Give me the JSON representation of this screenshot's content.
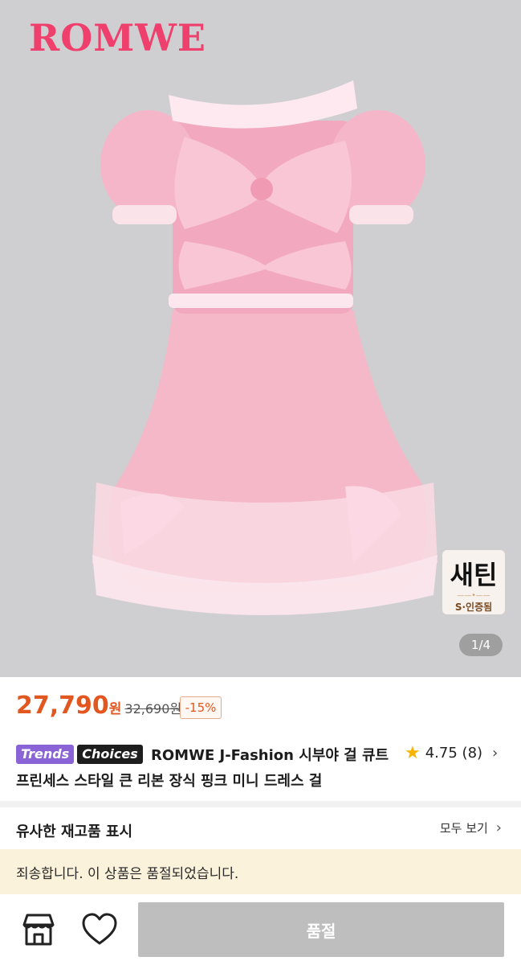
{
  "hero": {
    "brand_logo": "ROMWE",
    "badge_main": "새틴",
    "badge_sub": "S·인증됨",
    "page_indicator": "1/4"
  },
  "price": {
    "sale": "27,790",
    "unit": "원",
    "original": "32,690원",
    "discount": "-15%"
  },
  "product": {
    "tags": [
      "Trends",
      "Choices"
    ],
    "title": "ROMWE J-Fashion 시부야 걸 큐트 프린세스 스타일 큰 리본 장식 핑크 미니 드레스 걸",
    "rating": "4.75",
    "review_count": "(8)"
  },
  "similar": {
    "title": "유사한 재고품 표시",
    "see_all": "모두 보기"
  },
  "notice": "죄송합니다. 이 상품은 품절되었습니다.",
  "bottom_bar": {
    "soldout_label": "품절"
  },
  "colors": {
    "accent": "#e2571f",
    "brand": "#ef3f6c",
    "notice_bg": "#fbf2dc",
    "disabled_button": "#bebebe"
  },
  "icons": [
    "star-icon",
    "chevron-right-icon",
    "shop-icon",
    "heart-icon"
  ]
}
